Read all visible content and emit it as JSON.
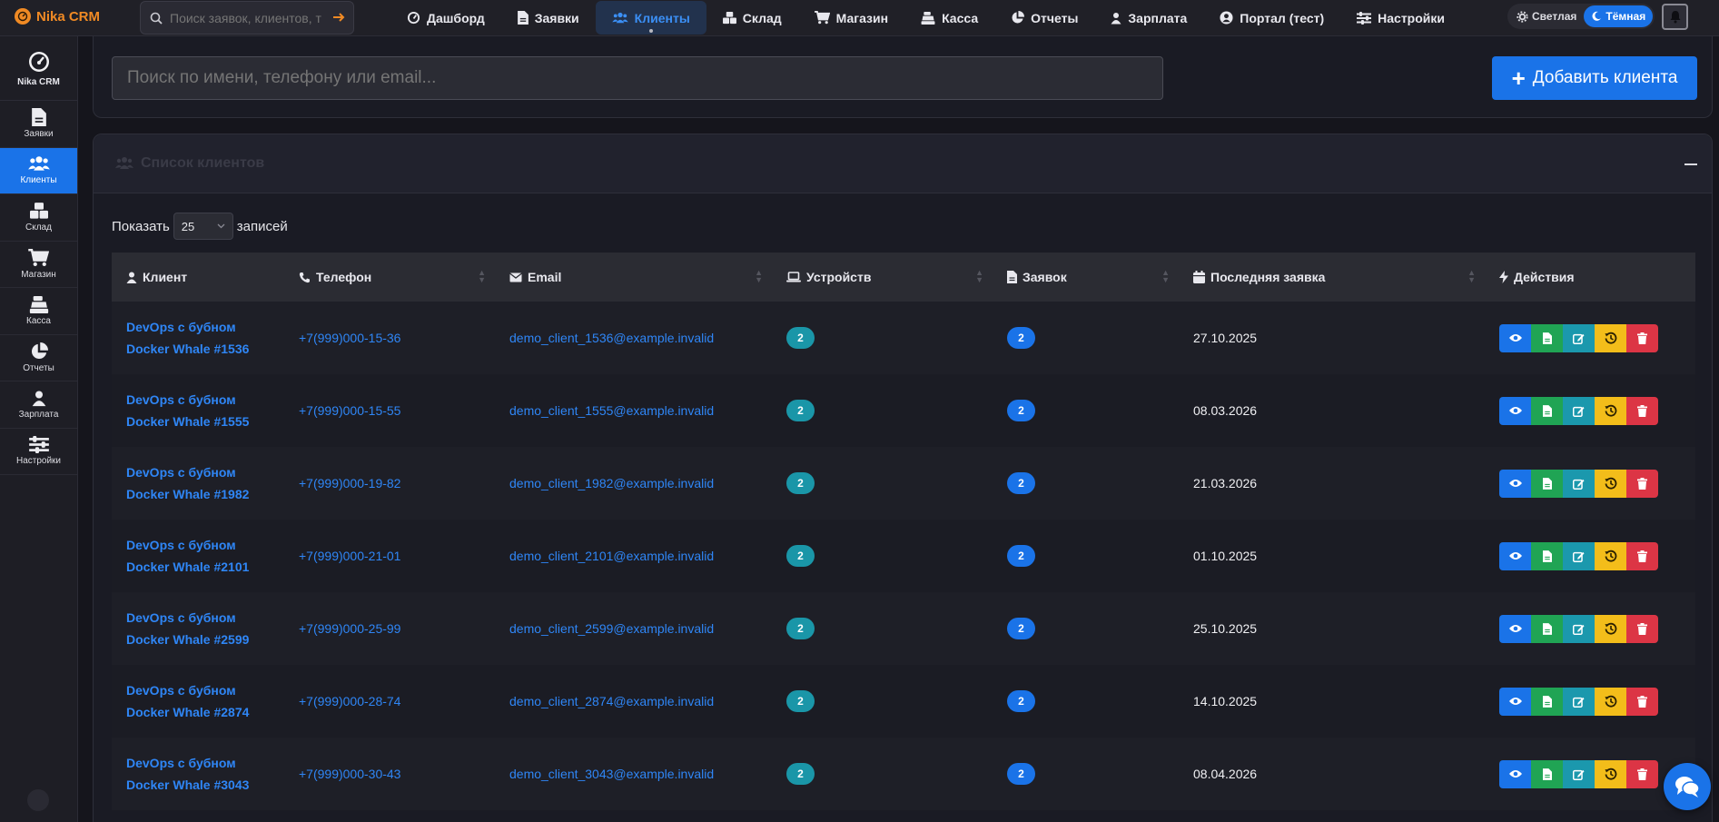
{
  "app": {
    "brand": "Nika CRM"
  },
  "topbar": {
    "search_placeholder": "Поиск заявок, клиентов, т",
    "nav": [
      {
        "label": "Дашборд",
        "icon": "gauge-icon"
      },
      {
        "label": "Заявки",
        "icon": "file-icon"
      },
      {
        "label": "Клиенты",
        "icon": "users-icon",
        "active": true
      },
      {
        "label": "Склад",
        "icon": "boxes-icon"
      },
      {
        "label": "Магазин",
        "icon": "cart-icon"
      },
      {
        "label": "Касса",
        "icon": "cash-register-icon"
      },
      {
        "label": "Отчеты",
        "icon": "pie-chart-icon"
      },
      {
        "label": "Зарплата",
        "icon": "user-icon"
      },
      {
        "label": "Портал (тест)",
        "icon": "user-circle-icon"
      },
      {
        "label": "Настройки",
        "icon": "sliders-icon"
      }
    ],
    "theme_light": "Светлая",
    "theme_dark": "Тёмная"
  },
  "sidebar": {
    "brand": "Nika CRM",
    "items": [
      {
        "label": "Заявки",
        "icon": "file-icon"
      },
      {
        "label": "Клиенты",
        "icon": "users-icon",
        "active": true
      },
      {
        "label": "Склад",
        "icon": "boxes-icon"
      },
      {
        "label": "Магазин",
        "icon": "cart-icon"
      },
      {
        "label": "Касса",
        "icon": "cash-register-icon"
      },
      {
        "label": "Отчеты",
        "icon": "pie-chart-icon"
      },
      {
        "label": "Зарплата",
        "icon": "user-icon"
      },
      {
        "label": "Настройки",
        "icon": "sliders-icon"
      }
    ]
  },
  "search": {
    "placeholder": "Поиск по имени, телефону или email...",
    "add_button": "Добавить клиента"
  },
  "list": {
    "title": "Список клиентов",
    "show_label": "Показать",
    "page_size": "25",
    "records_label": "записей",
    "columns": [
      "Клиент",
      "Телефон",
      "Email",
      "Устройств",
      "Заявок",
      "Последняя заявка",
      "Действия"
    ],
    "rows": [
      {
        "name": "DevOps с бубном Docker Whale #1536",
        "phone": "+7(999)000-15-36",
        "email": "demo_client_1536@example.invalid",
        "devices": "2",
        "orders": "2",
        "last": "27.10.2025"
      },
      {
        "name": "DevOps с бубном Docker Whale #1555",
        "phone": "+7(999)000-15-55",
        "email": "demo_client_1555@example.invalid",
        "devices": "2",
        "orders": "2",
        "last": "08.03.2026"
      },
      {
        "name": "DevOps с бубном Docker Whale #1982",
        "phone": "+7(999)000-19-82",
        "email": "demo_client_1982@example.invalid",
        "devices": "2",
        "orders": "2",
        "last": "21.03.2026"
      },
      {
        "name": "DevOps с бубном Docker Whale #2101",
        "phone": "+7(999)000-21-01",
        "email": "demo_client_2101@example.invalid",
        "devices": "2",
        "orders": "2",
        "last": "01.10.2025"
      },
      {
        "name": "DevOps с бубном Docker Whale #2599",
        "phone": "+7(999)000-25-99",
        "email": "demo_client_2599@example.invalid",
        "devices": "2",
        "orders": "2",
        "last": "25.10.2025"
      },
      {
        "name": "DevOps с бубном Docker Whale #2874",
        "phone": "+7(999)000-28-74",
        "email": "demo_client_2874@example.invalid",
        "devices": "2",
        "orders": "2",
        "last": "14.10.2025"
      },
      {
        "name": "DevOps с бубном Docker Whale #3043",
        "phone": "+7(999)000-30-43",
        "email": "demo_client_3043@example.invalid",
        "devices": "2",
        "orders": "2",
        "last": "08.04.2026"
      }
    ]
  },
  "colors": {
    "accent": "#1a73e8",
    "brand": "#f08a24",
    "success": "#20a454",
    "info": "#1b98ad",
    "warning": "#f3bd1a",
    "danger": "#dc3545"
  }
}
